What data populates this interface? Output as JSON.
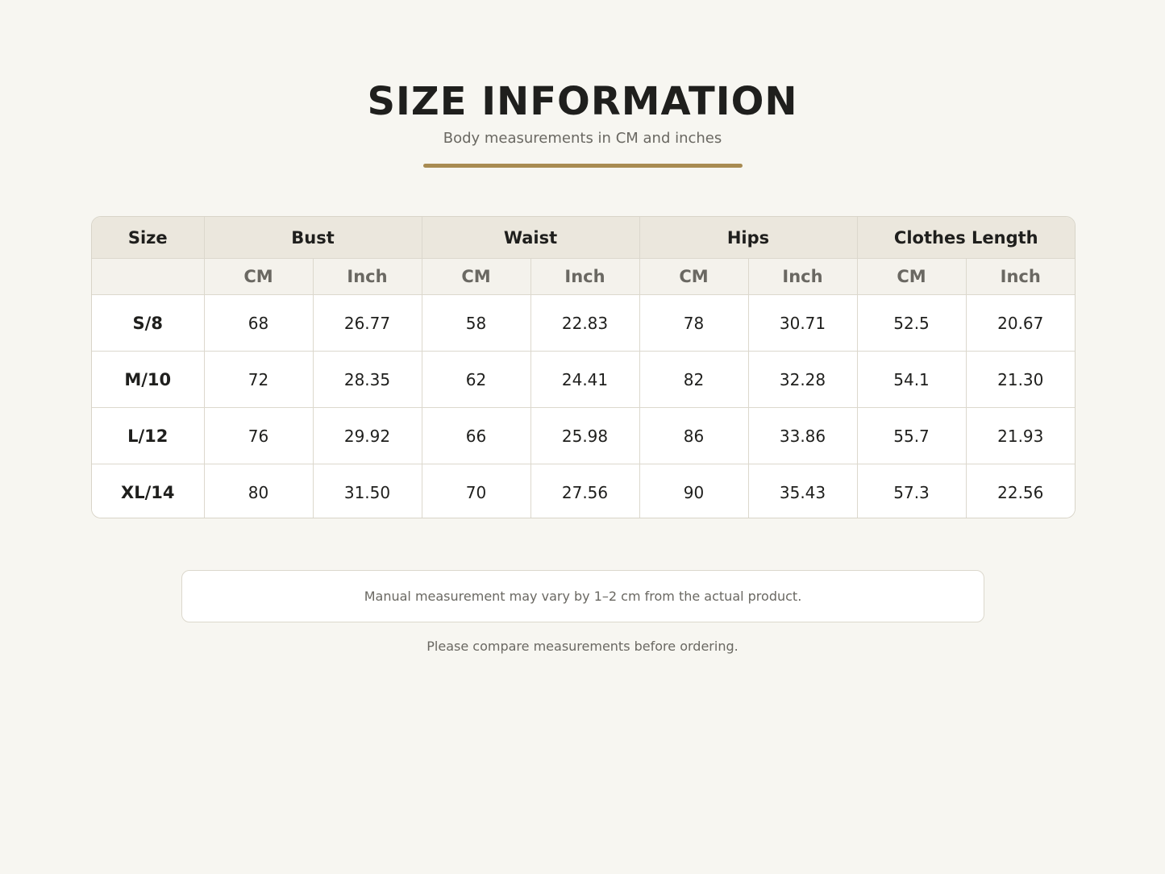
{
  "header": {
    "title": "SIZE INFORMATION",
    "subtitle": "Body measurements in CM and inches"
  },
  "colors": {
    "accent": "#a88b52",
    "background": "#f7f6f1",
    "header_row": "#ebe7dd",
    "units_row": "#f4f2ec"
  },
  "table": {
    "size_header": "Size",
    "groups": [
      "Bust",
      "Waist",
      "Hips",
      "Clothes Length"
    ],
    "units": [
      "CM",
      "Inch",
      "CM",
      "Inch",
      "CM",
      "Inch",
      "CM",
      "Inch"
    ],
    "rows": [
      {
        "size": "S/8",
        "values": [
          "68",
          "26.77",
          "58",
          "22.83",
          "78",
          "30.71",
          "52.5",
          "20.67"
        ]
      },
      {
        "size": "M/10",
        "values": [
          "72",
          "28.35",
          "62",
          "24.41",
          "82",
          "32.28",
          "54.1",
          "21.30"
        ]
      },
      {
        "size": "L/12",
        "values": [
          "76",
          "29.92",
          "66",
          "25.98",
          "86",
          "33.86",
          "55.7",
          "21.93"
        ]
      },
      {
        "size": "XL/14",
        "values": [
          "80",
          "31.50",
          "70",
          "27.56",
          "90",
          "35.43",
          "57.3",
          "22.56"
        ]
      }
    ]
  },
  "notes": {
    "disclaimer": "Manual measurement may vary by 1–2 cm from the actual product.",
    "footer": "Please compare measurements before ordering."
  }
}
